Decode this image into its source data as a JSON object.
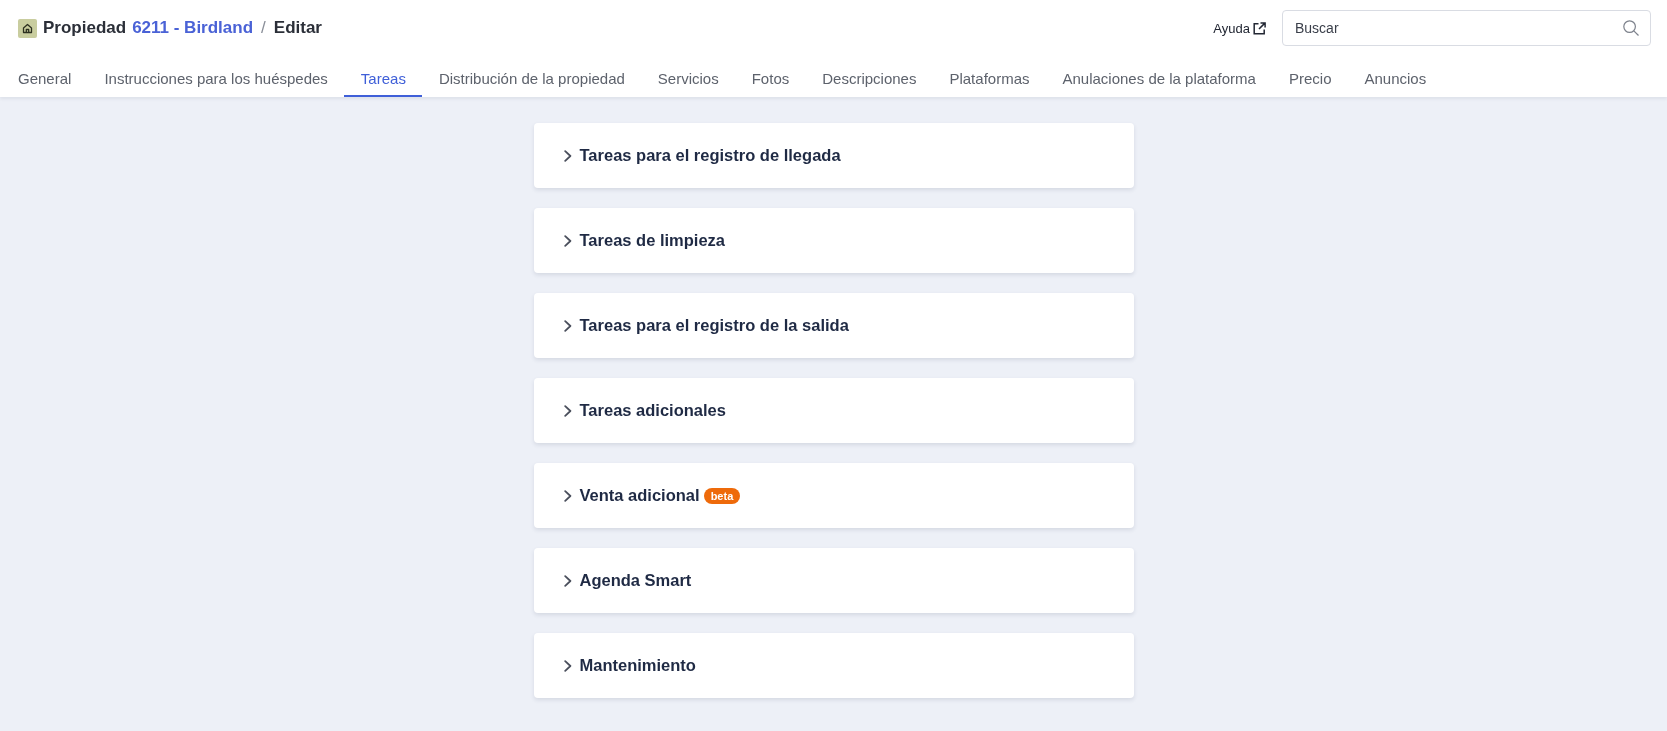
{
  "breadcrumb": {
    "label": "Propiedad",
    "property": "6211 - Birdland",
    "separator": "/",
    "current": "Editar"
  },
  "help_link": {
    "label": "Ayuda"
  },
  "search": {
    "placeholder": "Buscar"
  },
  "tabs": [
    {
      "label": "General",
      "selected": false
    },
    {
      "label": "Instrucciones para los huéspedes",
      "selected": false
    },
    {
      "label": "Tareas",
      "selected": true
    },
    {
      "label": "Distribución de la propiedad",
      "selected": false
    },
    {
      "label": "Servicios",
      "selected": false
    },
    {
      "label": "Fotos",
      "selected": false
    },
    {
      "label": "Descripciones",
      "selected": false
    },
    {
      "label": "Plataformas",
      "selected": false
    },
    {
      "label": "Anulaciones de la plataforma",
      "selected": false
    },
    {
      "label": "Precio",
      "selected": false
    },
    {
      "label": "Anuncios",
      "selected": false
    }
  ],
  "sections": [
    {
      "title": "Tareas para el registro de llegada",
      "expanded": false
    },
    {
      "title": "Tareas de limpieza",
      "expanded": false
    },
    {
      "title": "Tareas para el registro de la salida",
      "expanded": false
    },
    {
      "title": "Tareas adicionales",
      "expanded": false
    },
    {
      "title": "Venta adicional",
      "badge": "beta",
      "expanded": false
    },
    {
      "title": "Agenda Smart",
      "expanded": false
    },
    {
      "title": "Mantenimiento",
      "expanded": false
    }
  ]
}
